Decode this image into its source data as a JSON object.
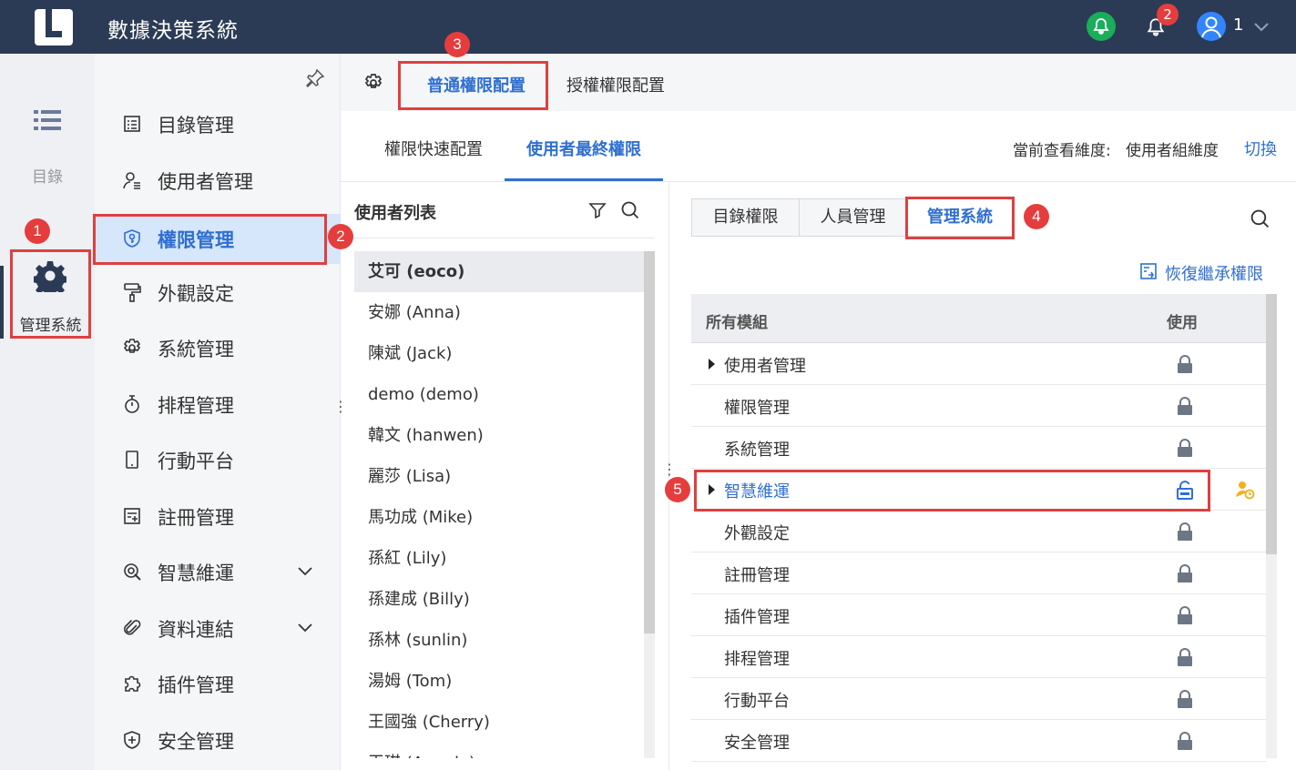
{
  "app": {
    "title": "數據決策系統",
    "notification_count": "2",
    "user_name": "1"
  },
  "rail": {
    "menu_label": "目錄",
    "system_label": "管理系統"
  },
  "sidebar": {
    "items": [
      {
        "label": "目錄管理",
        "icon": "list-doc-icon"
      },
      {
        "label": "使用者管理",
        "icon": "user-icon"
      },
      {
        "label": "權限管理",
        "icon": "shield-key-icon",
        "active": true
      },
      {
        "label": "外觀設定",
        "icon": "paint-roller-icon"
      },
      {
        "label": "系統管理",
        "icon": "gear-icon"
      },
      {
        "label": "排程管理",
        "icon": "stopwatch-icon"
      },
      {
        "label": "行動平台",
        "icon": "mobile-icon"
      },
      {
        "label": "註冊管理",
        "icon": "register-icon"
      },
      {
        "label": "智慧維運",
        "icon": "ops-icon",
        "expandable": true
      },
      {
        "label": "資料連結",
        "icon": "paperclip-icon",
        "expandable": true
      },
      {
        "label": "插件管理",
        "icon": "puzzle-icon"
      },
      {
        "label": "安全管理",
        "icon": "shield-plus-icon"
      }
    ]
  },
  "tabs": {
    "normal": "普通權限配置",
    "grant": "授權權限配置"
  },
  "subtabs": {
    "quick": "權限快速配置",
    "final": "使用者最終權限"
  },
  "dimension": {
    "label": "當前查看維度:",
    "value": "使用者組維度",
    "switch": "切換"
  },
  "userlist": {
    "title": "使用者列表",
    "users": [
      "艾可 (eoco)",
      "安娜 (Anna)",
      "陳斌 (Jack)",
      "demo (demo)",
      "韓文 (hanwen)",
      "麗莎 (Lisa)",
      "馬功成 (Mike)",
      "孫紅 (Lily)",
      "孫建成 (Billy)",
      "孫林 (sunlin)",
      "湯姆 (Tom)",
      "王國強 (Cherry)",
      "王琪 (Angela)"
    ]
  },
  "rightpane": {
    "segments": [
      "目錄權限",
      "人員管理",
      "管理系統"
    ],
    "restore": "恢復繼承權限",
    "col_module": "所有模組",
    "col_use": "使用",
    "modules": [
      {
        "name": "使用者管理",
        "expandable": true,
        "locked": true
      },
      {
        "name": "權限管理",
        "expandable": false,
        "locked": true
      },
      {
        "name": "系統管理",
        "expandable": false,
        "locked": true
      },
      {
        "name": "智慧維運",
        "expandable": true,
        "locked": false,
        "highlight": true
      },
      {
        "name": "外觀設定",
        "expandable": false,
        "locked": true
      },
      {
        "name": "註冊管理",
        "expandable": false,
        "locked": true
      },
      {
        "name": "插件管理",
        "expandable": false,
        "locked": true
      },
      {
        "name": "排程管理",
        "expandable": false,
        "locked": true
      },
      {
        "name": "行動平台",
        "expandable": false,
        "locked": true
      },
      {
        "name": "安全管理",
        "expandable": false,
        "locked": true
      }
    ]
  },
  "steps": [
    "1",
    "2",
    "3",
    "4",
    "5"
  ],
  "colors": {
    "topbar": "#2c3b55",
    "accent": "#2f6fd1",
    "highlight_box": "#e03f3f",
    "badge": "#e53d3d"
  }
}
